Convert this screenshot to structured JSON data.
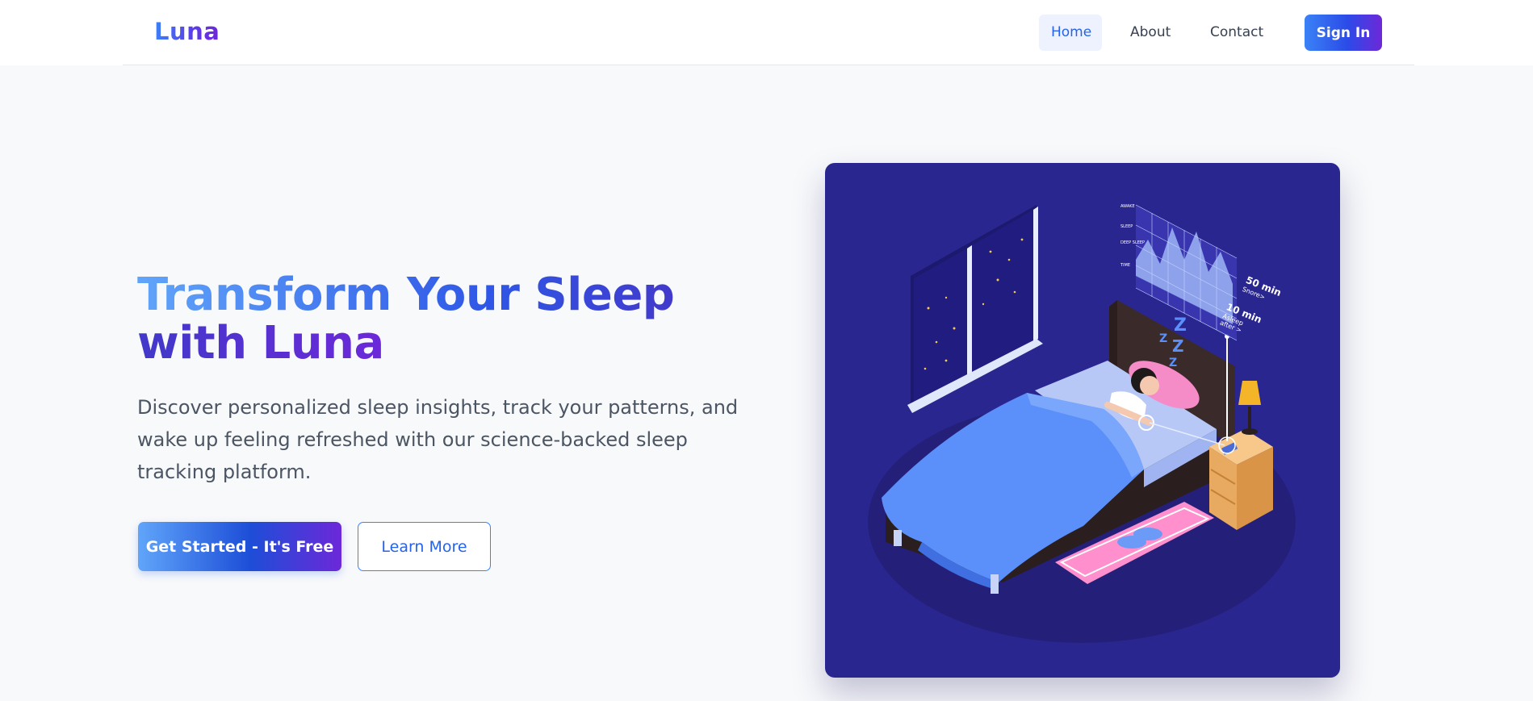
{
  "nav": {
    "logo": "Luna",
    "items": [
      {
        "label": "Home",
        "active": true
      },
      {
        "label": "About",
        "active": false
      },
      {
        "label": "Contact",
        "active": false
      }
    ],
    "signin_label": "Sign In"
  },
  "hero": {
    "title": "Transform Your Sleep with Luna",
    "subtitle": "Discover personalized sleep insights, track your patterns, and wake up feeling refreshed with our science-backed sleep tracking platform.",
    "primary_cta": "Get Started - It's Free",
    "secondary_cta": "Learn More"
  },
  "illustration": {
    "stat1_value": "50 min",
    "stat1_label": "Snore>",
    "stat2_value": "10 min",
    "stat2_label_1": "Asleep",
    "stat2_label_2": "after >",
    "chart_row_labels": [
      "AWAKE",
      "SLEEP",
      "DEEP SLEEP",
      "TIME"
    ],
    "zzz": "Z"
  },
  "colors": {
    "accent": "#2563eb",
    "gradient_start": "#60a5fa",
    "gradient_end": "#6d28d9",
    "illustration_bg": "#2a2690"
  }
}
